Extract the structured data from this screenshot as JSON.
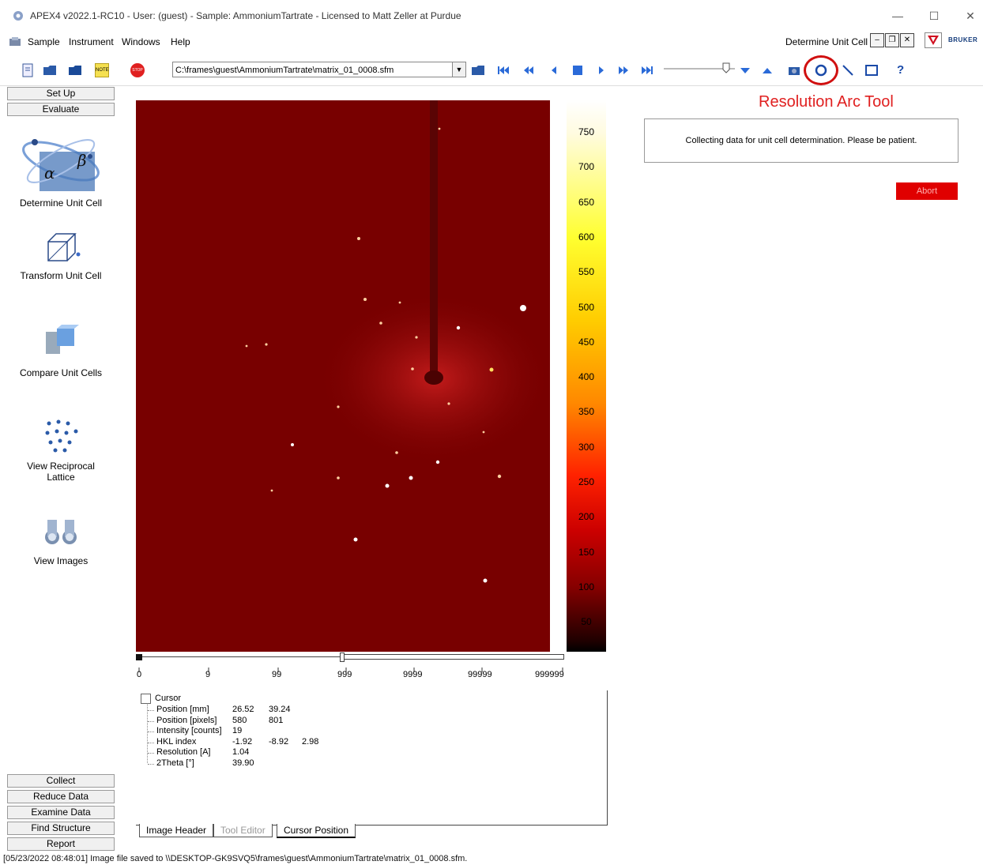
{
  "window": {
    "title": "APEX4 v2022.1-RC10 - User: (guest) - Sample: AmmoniumTartrate - Licensed to Matt Zeller at Purdue",
    "minimize": "—",
    "maximize": "☐",
    "close": "✕"
  },
  "menu": {
    "items": [
      "Sample",
      "Instrument",
      "Windows",
      "Help"
    ],
    "mode": "Determine Unit Cell",
    "brand": "BRUKER"
  },
  "toolbar": {
    "path": "C:\\frames\\guest\\AmmoniumTartrate\\matrix_01_0008.sfm",
    "note_label": "NOTE",
    "stop_label": "STOP",
    "help_label": "?"
  },
  "left_panel": {
    "top_buttons": [
      "Set Up",
      "Evaluate"
    ],
    "tools": [
      {
        "label": "Determine Unit Cell"
      },
      {
        "label": "Transform Unit Cell"
      },
      {
        "label": "Compare Unit Cells"
      },
      {
        "label": "View Reciprocal\nLattice"
      },
      {
        "label": "View Images"
      }
    ],
    "bottom_buttons": [
      "Collect",
      "Reduce Data",
      "Examine Data",
      "Find Structure",
      "Report"
    ]
  },
  "colorbar": {
    "labels": [
      "750",
      "700",
      "650",
      "600",
      "550",
      "500",
      "450",
      "400",
      "350",
      "300",
      "250",
      "200",
      "150",
      "100",
      "50"
    ]
  },
  "slider": {
    "ticks": [
      "0",
      "9",
      "99",
      "999",
      "9999",
      "99999",
      "999999"
    ]
  },
  "cursor_info": {
    "header": "Cursor",
    "rows": [
      {
        "label": "Position [mm]",
        "v1": "26.52",
        "v2": "39.24",
        "v3": ""
      },
      {
        "label": "Position [pixels]",
        "v1": "580",
        "v2": "801",
        "v3": ""
      },
      {
        "label": "Intensity [counts]",
        "v1": "19",
        "v2": "",
        "v3": ""
      },
      {
        "label": "HKL index",
        "v1": "-1.92",
        "v2": "-8.92",
        "v3": "2.98"
      },
      {
        "label": "Resolution [A]",
        "v1": "1.04",
        "v2": "",
        "v3": ""
      },
      {
        "label": "2Theta [°]",
        "v1": "39.90",
        "v2": "",
        "v3": ""
      }
    ]
  },
  "tabs": [
    "Image Header",
    "Tool Editor",
    "Cursor Position"
  ],
  "right_panel": {
    "title": "Resolution Arc Tool",
    "message": "Collecting data for unit cell determination. Please be patient.",
    "abort": "Abort"
  },
  "status": "[05/23/2022 08:48:01] Image file saved to \\\\DESKTOP-GK9SVQ5\\frames\\guest\\AmmoniumTartrate\\matrix_01_0008.sfm."
}
